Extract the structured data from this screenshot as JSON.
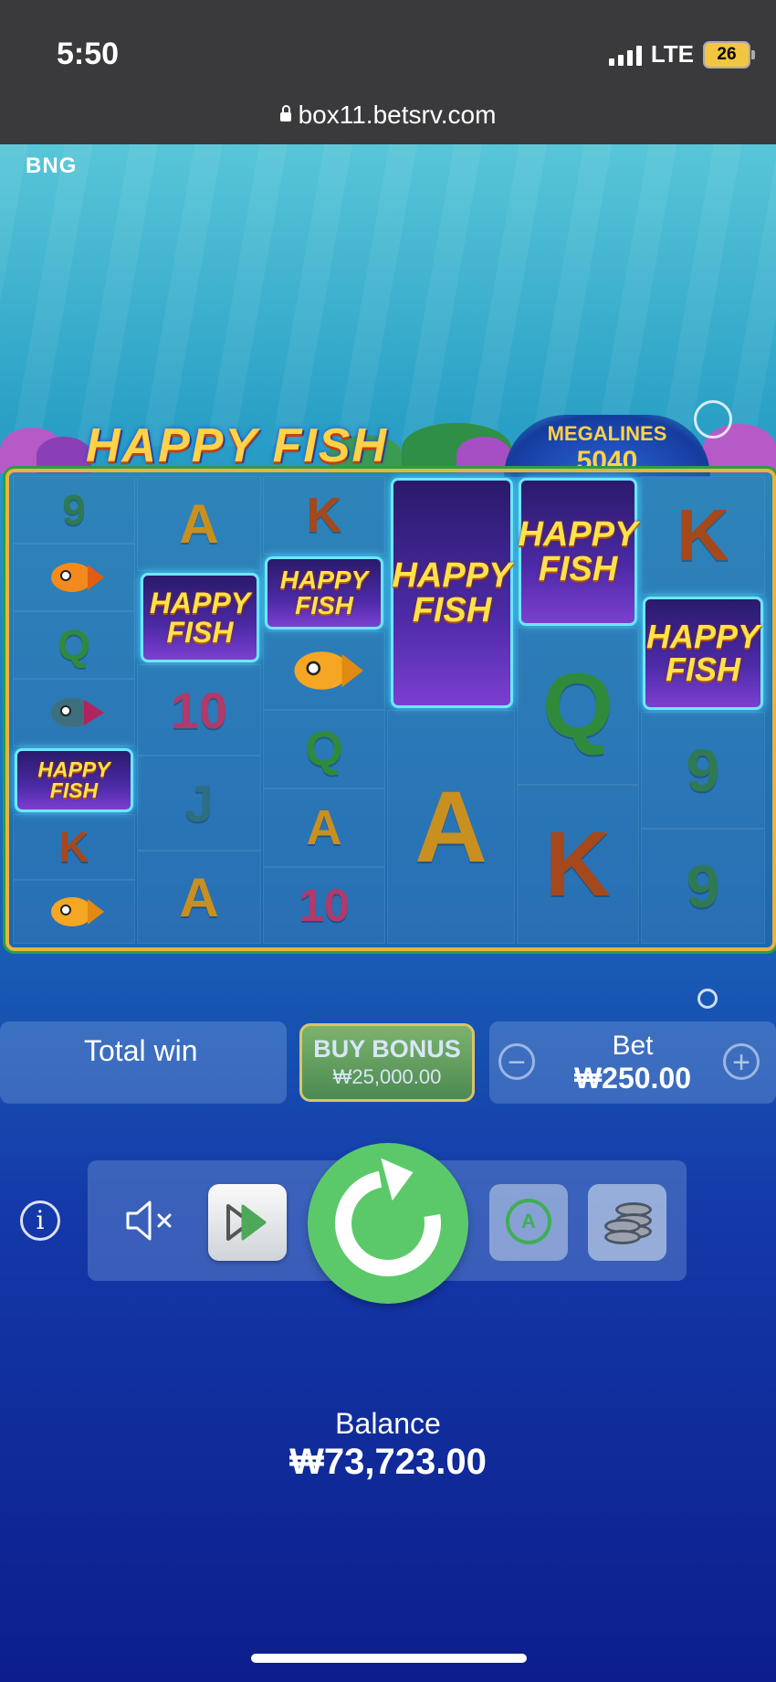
{
  "status_bar": {
    "time": "5:50",
    "network": "LTE",
    "battery": "26"
  },
  "browser": {
    "url": "box11.betsrv.com"
  },
  "game": {
    "provider": "BNG",
    "title": "HAPPY FISH",
    "megalines_label": "MEGALINES",
    "megalines_value": "5040",
    "reels": [
      [
        "9",
        "fish-orange",
        "Q",
        "fish-purple",
        "HAPPY FISH",
        "K",
        "fish-orange"
      ],
      [
        "A",
        "HAPPY FISH",
        "10",
        "J",
        "A"
      ],
      [
        "K",
        "HAPPY FISH",
        "fish-orange",
        "Q",
        "A",
        "10"
      ],
      [
        "HAPPY FISH",
        "A"
      ],
      [
        "HAPPY FISH",
        "Q",
        "K"
      ],
      [
        "K",
        "HAPPY FISH",
        "9",
        "9"
      ]
    ],
    "happy_fish_line1": "HAPPY",
    "happy_fish_line2": "FISH"
  },
  "controls": {
    "total_win_label": "Total win",
    "buy_bonus_label": "BUY BONUS",
    "buy_bonus_price": "₩25,000.00",
    "bet_label": "Bet",
    "bet_value": "₩250.00",
    "bet_minus": "−",
    "bet_plus": "+",
    "info": "i",
    "auto_letter": "A"
  },
  "balance": {
    "label": "Balance",
    "value": "₩73,723.00"
  },
  "colors": {
    "spin": "#5bc96a",
    "gold": "#ffd24a",
    "frame": "#e6b53c"
  }
}
